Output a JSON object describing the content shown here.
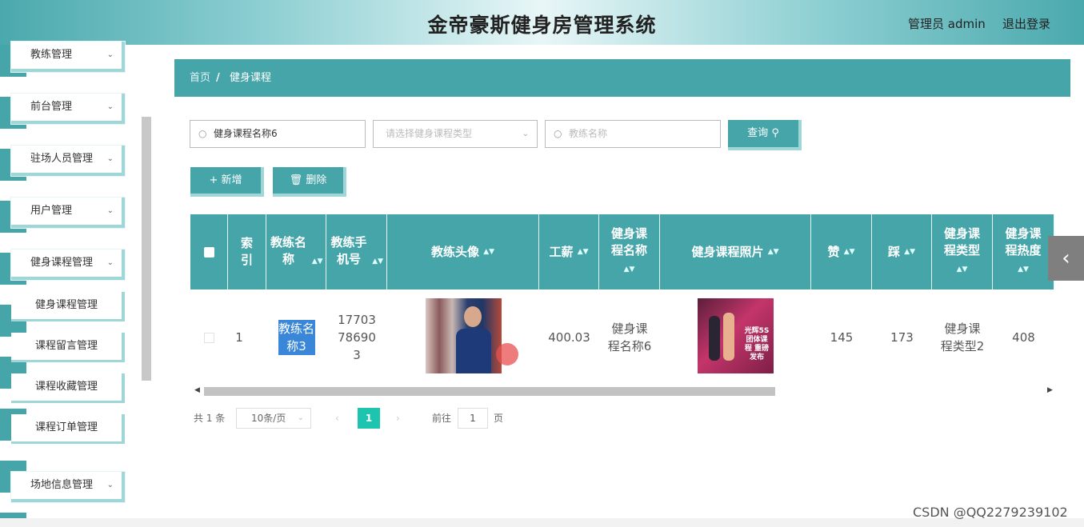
{
  "header": {
    "title": "金帝豪斯健身房管理系统",
    "user": "管理员 admin",
    "logout": "退出登录"
  },
  "sidebar": {
    "items": [
      {
        "label": "教练管理"
      },
      {
        "label": "前台管理"
      },
      {
        "label": "驻场人员管理"
      },
      {
        "label": "用户管理"
      },
      {
        "label": "健身课程管理"
      },
      {
        "label": "场地信息管理"
      }
    ],
    "subitems": [
      {
        "label": "健身课程管理"
      },
      {
        "label": "课程留言管理"
      },
      {
        "label": "课程收藏管理"
      },
      {
        "label": "课程订单管理"
      }
    ]
  },
  "breadcrumb": {
    "home": "首页",
    "sep": "/",
    "current": "健身课程"
  },
  "search": {
    "course_name_value": "健身课程名称6",
    "course_type_placeholder": "请选择健身课程类型",
    "coach_placeholder": "教练名称",
    "query_label": "查询"
  },
  "actions": {
    "add_label": "新增",
    "delete_label": "删除"
  },
  "table": {
    "headers": [
      "索引",
      "教练名称",
      "教练手机号",
      "教练头像",
      "工薪",
      "健身课程名称",
      "健身课程照片",
      "赞",
      "踩",
      "健身课程类型",
      "健身课程热度"
    ],
    "row": {
      "index": "1",
      "coach_name": "教练名称3",
      "coach_phone": "17703786903",
      "salary": "400.03",
      "course_name": "健身课程名称6",
      "likes": "145",
      "dislikes": "173",
      "course_type": "健身课程类型2",
      "heat": "408"
    },
    "photo_text": "光辉5S 团体课程 重磅发布"
  },
  "pagination": {
    "total": "共 1 条",
    "page_size": "10条/页",
    "current": "1",
    "goto_prefix": "前往",
    "goto_value": "1",
    "goto_suffix": "页"
  },
  "watermark": "CSDN @QQ2279239102",
  "colors": {
    "primary": "#45a5a9",
    "accent_light": "#9fd6d8",
    "page_active": "#1dc5b0"
  }
}
